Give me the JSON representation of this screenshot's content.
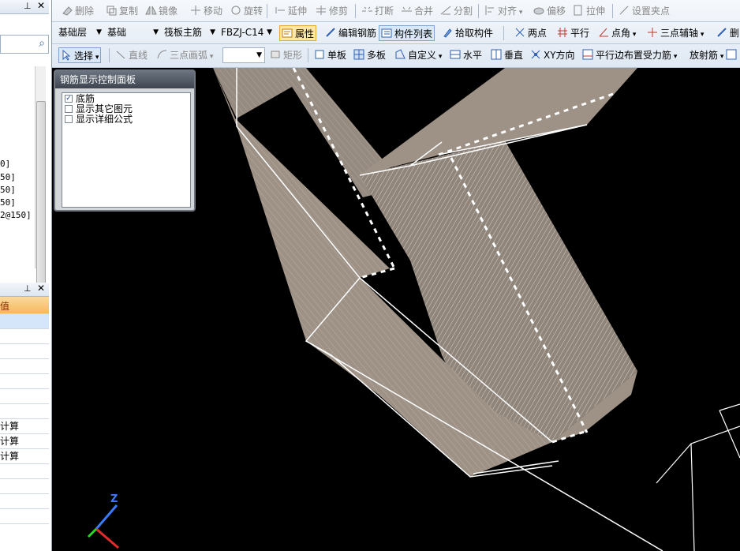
{
  "toolbar_edit": {
    "delete": "删除",
    "copy": "复制",
    "mirror": "镜像",
    "move": "移动",
    "rotate": "旋转",
    "extend": "延伸",
    "trim": "修剪",
    "break": "打断",
    "merge": "合并",
    "split": "分割",
    "align": "对齐",
    "offset": "偏移",
    "stretch": "拉伸",
    "set_grip": "设置夹点"
  },
  "toolbar_props": {
    "floor": "基础层",
    "category": "基础",
    "element_type": "筏板主筋",
    "element_name": "FBZJ-C14",
    "property": "属性",
    "edit_rebar": "编辑钢筋",
    "element_list": "构件列表",
    "pick_element": "拾取构件",
    "two_points": "两点",
    "parallel": "平行",
    "point_angle": "点角",
    "three_point_axis": "三点辅轴",
    "delete_short": "删"
  },
  "toolbar_draw": {
    "select": "选择",
    "line": "直线",
    "three_point_arc": "三点画弧",
    "rect": "矩形",
    "single_slab": "单板",
    "multi_slab": "多板",
    "custom": "自定义",
    "horizontal": "水平",
    "vertical": "垂直",
    "xy_direction": "XY方向",
    "parallel_edge_rebar": "平行边布置受力筋",
    "radial_rebar": "放射筋"
  },
  "left_list": [
    "0]",
    "50]",
    "50]",
    "50]",
    "2@150]"
  ],
  "prop_rows": [
    "值",
    "",
    "",
    "",
    "",
    "",
    "",
    "",
    "计算",
    "计算",
    "计算",
    "",
    "",
    "",
    ""
  ],
  "rebar_panel": {
    "title": "钢筋显示控制面板",
    "options": [
      {
        "label": "底筋",
        "checked": true
      },
      {
        "label": "显示其它图元",
        "checked": false
      },
      {
        "label": "显示详细公式",
        "checked": false
      }
    ]
  },
  "axis": {
    "z_label": "Z"
  },
  "colors": {
    "slab": "#9e9287",
    "wire": "#ffffff",
    "accent": "#f6b95c"
  }
}
